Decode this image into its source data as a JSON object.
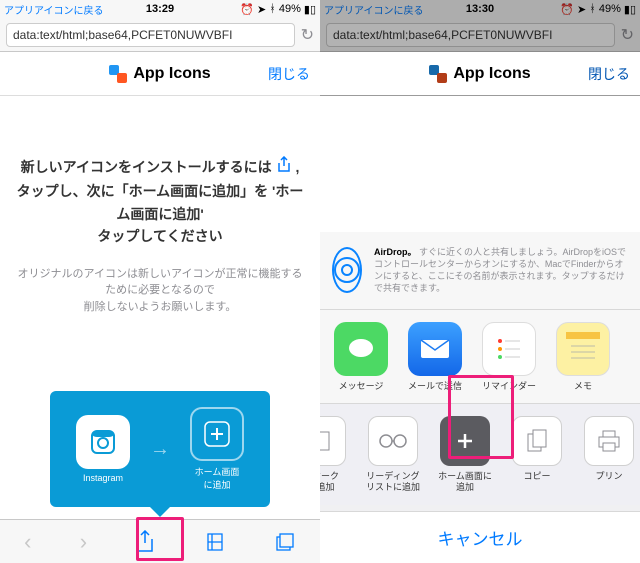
{
  "left": {
    "status": {
      "back": "アプリアイコンに戻る",
      "time": "13:29",
      "battery": "49%"
    },
    "addr": "data:text/html;base64,PCFET0NUWVBFI",
    "header": {
      "title": "App Icons",
      "close": "閉じる"
    },
    "instruction_main": "新しいアイコンをインストールするには ⬆︎ ,タップし、次に「ホーム画面に追加」を 'ホーム画面に追加'\nタップしてください",
    "instruction_sub": "オリジナルのアイコンは新しいアイコンが正常に機能するために必要となるので\n削除しないようお願いします。",
    "tooltip": {
      "source": "Instagram",
      "target": "ホーム画面\nに追加"
    }
  },
  "right": {
    "status": {
      "back": "アプリアイコンに戻る",
      "time": "13:30",
      "battery": "49%"
    },
    "addr": "data:text/html;base64,PCFET0NUWVBFI",
    "header": {
      "title": "App Icons",
      "close": "閉じる"
    },
    "airdrop": {
      "title": "AirDrop。",
      "body": "すぐに近くの人と共有しましょう。AirDropをiOSでコントロールセンターからオンにするか、MacでFinderからオンにすると、ここにその名前が表示されます。タップするだけで共有できます。"
    },
    "share": [
      {
        "label": "メッセージ",
        "color": "#4cd964"
      },
      {
        "label": "メールで送信",
        "color": "#1d7cf2"
      },
      {
        "label": "リマインダー",
        "color": "#fff"
      },
      {
        "label": "メモ",
        "color": "#fdf1a3"
      }
    ],
    "actions": [
      {
        "label": "クマーク\nに追加"
      },
      {
        "label": "リーディング\nリストに追加"
      },
      {
        "label": "ホーム画面に\n追加"
      },
      {
        "label": "コピー"
      },
      {
        "label": "プリン"
      }
    ],
    "cancel": "キャンセル"
  }
}
